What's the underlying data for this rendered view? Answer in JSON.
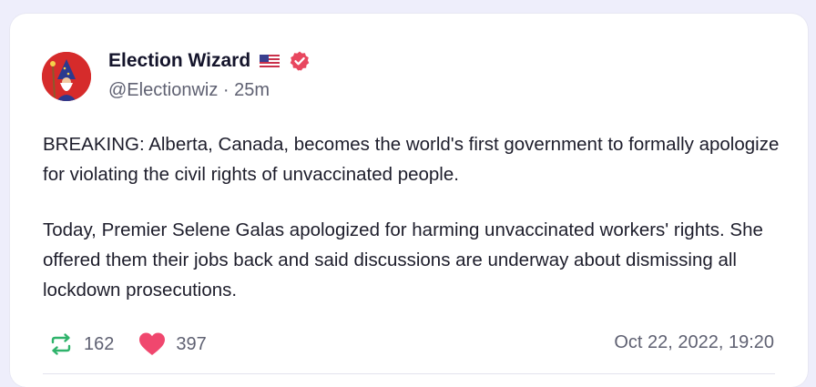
{
  "author": {
    "name": "Election Wizard",
    "handle": "@Electionwiz",
    "age": "25m",
    "flag_icon": "us-flag-icon",
    "badge_icon": "verified-badge-icon",
    "avatar_icon": "wizard-avatar"
  },
  "post": {
    "paragraph1": "BREAKING: Alberta, Canada, becomes the world's first government to formally apologize for violating the civil rights of unvaccinated people.",
    "paragraph2": "Today, Premier Selene Galas apologized for harming unvaccinated workers' rights. She offered them their jobs back and said discussions are underway about dismissing all lockdown prosecutions."
  },
  "stats": {
    "reposts": "162",
    "likes": "397",
    "timestamp": "Oct 22, 2022, 19:20"
  },
  "colors": {
    "repost": "#2fb36b",
    "like": "#f0476e",
    "verified": "#e8475f",
    "avatar_bg": "#d62b2b"
  }
}
